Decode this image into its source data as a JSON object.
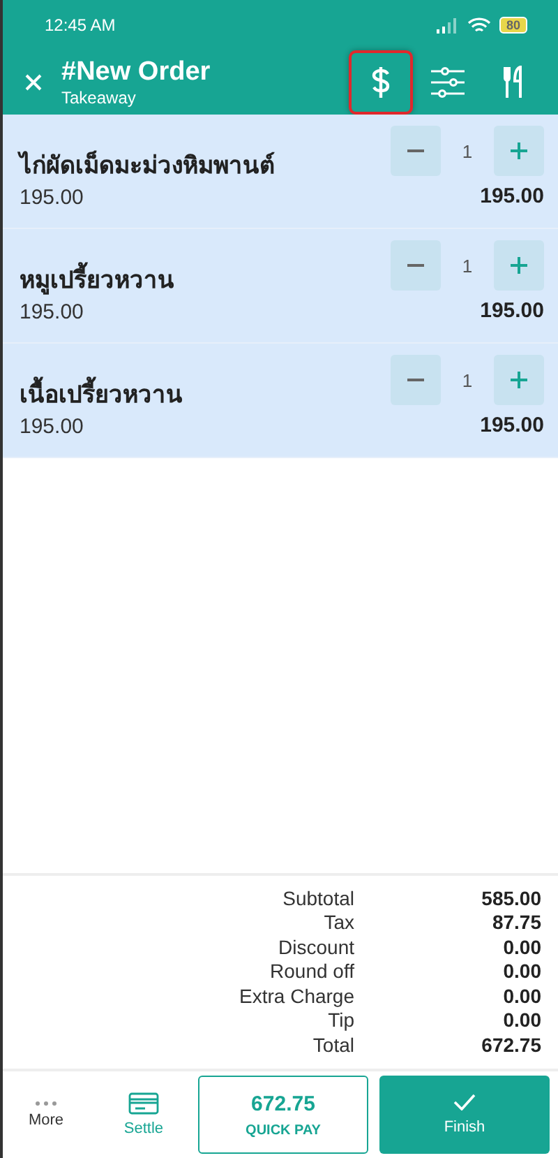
{
  "status_bar": {
    "time": "12:45 AM",
    "battery": "80"
  },
  "header": {
    "title": "#New Order",
    "subtitle": "Takeaway",
    "actions": [
      {
        "kind": "dollar",
        "highlighted": true
      },
      {
        "kind": "sliders",
        "highlighted": false
      },
      {
        "kind": "cutlery",
        "highlighted": false
      }
    ]
  },
  "items": [
    {
      "name": "ไก่ผัดเม็ดมะม่วงหิมพานต์",
      "price": "195.00",
      "quantity": "1",
      "amount": "195.00"
    },
    {
      "name": "หมูเปรี้ยวหวาน",
      "price": "195.00",
      "quantity": "1",
      "amount": "195.00"
    },
    {
      "name": "เนื้อเปรี้ยวหวาน",
      "price": "195.00",
      "quantity": "1",
      "amount": "195.00"
    }
  ],
  "totals": [
    {
      "label": "Subtotal",
      "value": "585.00"
    },
    {
      "label": "Tax",
      "value": "87.75"
    },
    {
      "label": "Discount",
      "value": "0.00"
    },
    {
      "label": "Round off",
      "value": "0.00"
    },
    {
      "label": "Extra Charge",
      "value": "0.00"
    },
    {
      "label": "Tip",
      "value": "0.00"
    },
    {
      "label": "Total",
      "value": "672.75"
    }
  ],
  "bottom_bar": {
    "more": "More",
    "settle": "Settle",
    "quick_pay": {
      "amount": "672.75",
      "label": "QUICK PAY"
    },
    "finish": "Finish"
  }
}
